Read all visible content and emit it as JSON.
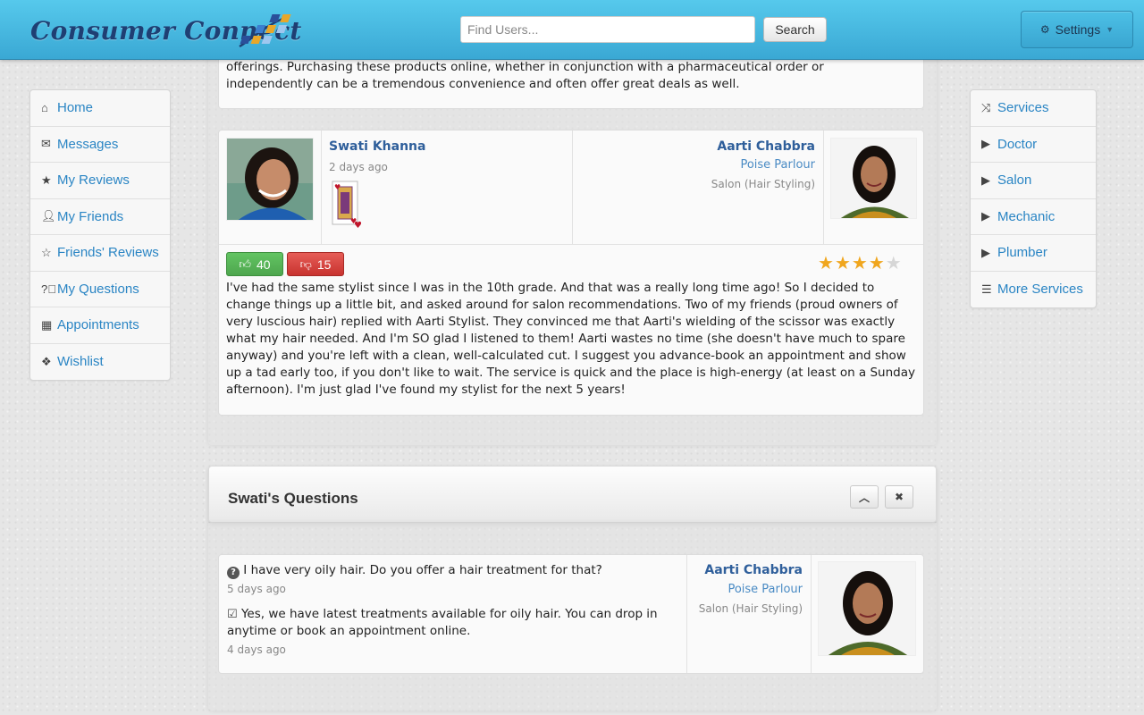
{
  "header": {
    "brand": "Consumer Connect",
    "search_placeholder": "Find Users...",
    "search_button": "Search",
    "settings_label": "Settings"
  },
  "left_nav": [
    {
      "label": "Home",
      "icon": "home-icon"
    },
    {
      "label": "Messages",
      "icon": "envelope-icon"
    },
    {
      "label": "My Reviews",
      "icon": "star-icon"
    },
    {
      "label": "My Friends",
      "icon": "user-icon"
    },
    {
      "label": "Friends' Reviews",
      "icon": "star-outline-icon"
    },
    {
      "label": "My Questions",
      "icon": "question-circle-icon"
    },
    {
      "label": "Appointments",
      "icon": "calendar-icon"
    },
    {
      "label": "Wishlist",
      "icon": "gift-icon"
    }
  ],
  "right_nav": [
    {
      "label": "Services",
      "icon": "shuffle-icon"
    },
    {
      "label": "Doctor",
      "icon": "play-icon"
    },
    {
      "label": "Salon",
      "icon": "play-icon"
    },
    {
      "label": "Mechanic",
      "icon": "play-icon"
    },
    {
      "label": "Plumber",
      "icon": "play-icon"
    },
    {
      "label": "More Services",
      "icon": "list-icon"
    }
  ],
  "previous_review_tail": {
    "line1": "offerings. Purchasing these products online, whether in conjunction with a pharmaceutical order or",
    "line2": "independently can be a tremendous convenience and often offer great deals as well."
  },
  "review": {
    "reviewer_name": "Swati Khanna",
    "time_ago": "2 days ago",
    "badge": "queen-of-hearts-card",
    "provider_name": "Aarti Chabbra",
    "business": "Poise Parlour",
    "category": "Salon (Hair Styling)",
    "upvotes": "40",
    "downvotes": "15",
    "rating": 4,
    "rating_max": 5,
    "text": "I've had the same stylist since I was in the 10th grade. And that was a really long time ago! So I decided to change things up a little bit, and asked around for salon recommendations. Two of my friends (proud owners of very luscious hair) replied with Aarti Stylist. They convinced me that Aarti's wielding of the scissor was exactly what my hair needed. And I'm SO glad I listened to them! Aarti wastes no time (she doesn't have much to spare anyway) and you're left with a clean, well-calculated cut. I suggest you advance-book an appointment and show up a tad early too, if you don't like to wait. The service is quick and the place is high-energy (at least on a Sunday afternoon). I'm just glad I've found my stylist for the next 5 years!"
  },
  "questions_panel": {
    "title": "Swati's Questions",
    "question": "I have very oily hair. Do you offer a hair treatment for that?",
    "question_time": "5 days ago",
    "answer": "Yes, we have latest treatments available for oily hair. You can drop in anytime or book an appointment online.",
    "answer_time": "4 days ago",
    "provider_name": "Aarti Chabbra",
    "business": "Poise Parlour",
    "category": "Salon (Hair Styling)"
  },
  "colors": {
    "header": "#45b8e2",
    "link": "#2a85c4",
    "upvote": "#5bb75b",
    "downvote": "#da4f49",
    "star": "#f0a61e"
  }
}
